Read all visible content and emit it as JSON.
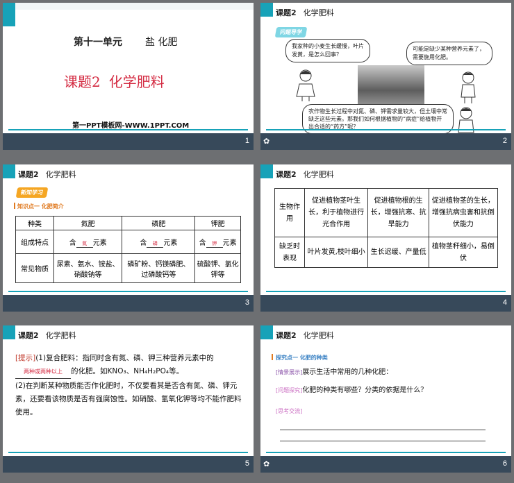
{
  "slides": {
    "s1": {
      "unit": "第十一单元",
      "unit_topic": "盐 化肥",
      "lesson_no": "课题2",
      "lesson_title": "化学肥料",
      "site": "第一PPT模板网-WWW.1PPT.COM",
      "page": "1"
    },
    "s2": {
      "header_no": "课题2",
      "header_title": "化学肥料",
      "chip": "问题导学",
      "bubble_left": "我家种的小麦生长缓慢，叶片发黄，是怎么回事？",
      "bubble_right": "可能是缺少某种营养元素了，需要施用化肥。",
      "bubble_bottom": "农作物生长过程中对氮、磷、钾需求量较大，但土壤中常缺乏这些元素。那我们如何根据植物的“病症”给植物开出合适的“药方”呢？",
      "page": "2"
    },
    "s3": {
      "header_no": "课题2",
      "header_title": "化学肥料",
      "chip": "新知学习",
      "kp": "知识点一  化肥简介",
      "table": {
        "headers": [
          "种类",
          "氮肥",
          "磷肥",
          "钾肥"
        ],
        "row1_label": "组成特点",
        "row1_prefix": "含",
        "row1_suffix": "元素",
        "row1_fills": [
          "氮",
          "磷",
          "钾"
        ],
        "row2_label": "常见物质",
        "row2": [
          "尿素、氨水、铵盐、硝酸钠等",
          "磷矿粉、钙镁磷肥、过磷酸钙等",
          "硫酸钾、氯化钾等"
        ]
      },
      "page": "3"
    },
    "s4": {
      "header_no": "课题2",
      "header_title": "化学肥料",
      "table": {
        "row1_label": "生物作用",
        "row1": [
          "促进植物茎叶生长，利于植物进行光合作用",
          "促进植物根的生长，增强抗寒、抗旱能力",
          "促进植物茎的生长，增强抗病虫害和抗倒伏能力"
        ],
        "row2_label": "缺乏时表现",
        "row2": [
          "叶片发黄,枝叶细小",
          "生长迟缓、产量低",
          "植物茎秆细小，易倒伏"
        ]
      },
      "page": "4"
    },
    "s5": {
      "header_no": "课题2",
      "header_title": "化学肥料",
      "tip_label": "[提示]",
      "p1_a": "(1)复合肥料：指同时含有氮、磷、钾三种营养元素中的",
      "p1_fill": "两种或两种以上",
      "p1_b": "的化肥。如KNO₃、NH₄H₂PO₄等。",
      "p2": "(2)在判断某种物质能否作化肥时，不仅要看其是否含有氮、磷、钾元素，还要看该物质是否有强腐蚀性。如硝酸、氢氧化钾等均不能作肥料使用。",
      "page": "5"
    },
    "s6": {
      "header_no": "课题2",
      "header_title": "化学肥料",
      "kp": "探究点一  化肥的种类",
      "tag1": "[情景展示]",
      "text1": "展示生活中常用的几种化肥：",
      "tag2": "[问题探究]",
      "text2": "化肥的种类有哪些？分类的依据是什么？",
      "tag3": "[思考交流]",
      "page": "6"
    }
  },
  "colors": {
    "frame": "#17a2b8",
    "bar": "#37495a",
    "accent_red": "#d42b42"
  }
}
